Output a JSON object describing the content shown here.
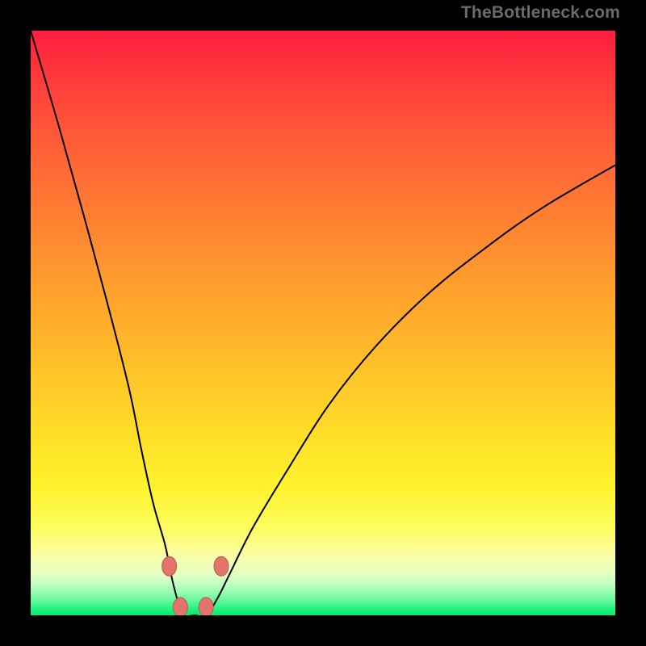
{
  "attribution": "TheBottleneck.com",
  "chart_data": {
    "type": "line",
    "title": "",
    "xlabel": "",
    "ylabel": "",
    "xlim": [
      0,
      1
    ],
    "ylim": [
      0,
      1
    ],
    "series": [
      {
        "name": "bottleneck-curve",
        "x": [
          0.0,
          0.05,
          0.1,
          0.14,
          0.17,
          0.19,
          0.21,
          0.23,
          0.24,
          0.25,
          0.26,
          0.28,
          0.3,
          0.32,
          0.34,
          0.38,
          0.44,
          0.51,
          0.59,
          0.68,
          0.78,
          0.88,
          1.0
        ],
        "y": [
          1.0,
          0.83,
          0.65,
          0.5,
          0.38,
          0.28,
          0.19,
          0.12,
          0.07,
          0.03,
          0.0,
          0.0,
          0.0,
          0.03,
          0.07,
          0.15,
          0.25,
          0.36,
          0.46,
          0.55,
          0.63,
          0.7,
          0.77
        ]
      }
    ],
    "markers": [
      {
        "x": 0.237,
        "y": 0.084,
        "color": "#e2746c"
      },
      {
        "x": 0.256,
        "y": 0.014,
        "color": "#e2746c"
      },
      {
        "x": 0.3,
        "y": 0.014,
        "color": "#e2746c"
      },
      {
        "x": 0.326,
        "y": 0.084,
        "color": "#e2746c"
      }
    ],
    "colors": {
      "curve": "#000000",
      "marker_fill": "#e2746c",
      "marker_stroke": "#bc5a52",
      "background_top": "#ff1d3f",
      "background_bottom": "#00ee6e",
      "frame": "#000000"
    }
  }
}
